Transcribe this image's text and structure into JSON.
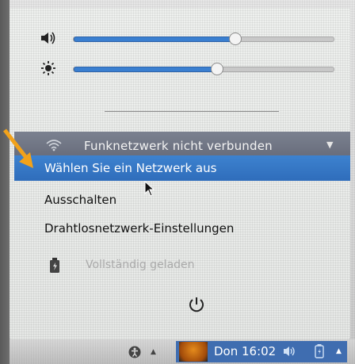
{
  "sliders": [
    {
      "icon": "volume-icon",
      "level": 0.62
    },
    {
      "icon": "brightness-icon",
      "level": 0.55
    }
  ],
  "wifi": {
    "status_label": "Funknetzwerk nicht verbunden",
    "icon": "wifi-icon"
  },
  "menu_items": [
    {
      "label": "Wählen Sie ein Netzwerk aus",
      "active": true
    },
    {
      "label": "Ausschalten",
      "active": false
    },
    {
      "label": "Drahtlosnetzwerk-Einstellungen",
      "active": false
    }
  ],
  "battery": {
    "label": "Vollständig geladen",
    "icon": "battery-charged-icon"
  },
  "power": {
    "icon": "power-icon"
  },
  "panel": {
    "clock": "Don 16:02",
    "icons": [
      "accessibility-icon",
      "volume-icon",
      "battery-icon"
    ]
  },
  "colors": {
    "accent": "#3a7fd0",
    "header": "#6e7383",
    "annotation_arrow": "#f2a21a"
  }
}
